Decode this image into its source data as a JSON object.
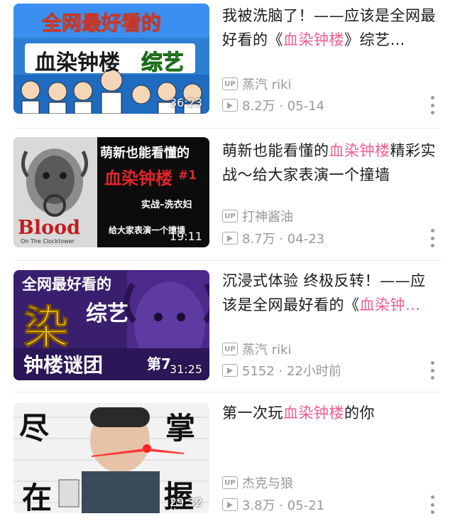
{
  "videos": [
    {
      "title_parts": [
        "我被洗脑了！——应该是全网最好看的《",
        "血染钟楼",
        "》综艺…"
      ],
      "uploader": "蒸汽 riki",
      "stats": "8.2万 · 05-14",
      "duration": "36:23",
      "thumb_text": {
        "line1": "全网最好看的",
        "line2": "血染钟楼",
        "line2b": "综艺"
      }
    },
    {
      "title_parts": [
        "萌新也能看懂的",
        "血染钟楼",
        "精彩实战～给大家表演一个撞墙"
      ],
      "uploader": "打神酱油",
      "stats": "8.7万 · 04-23",
      "duration": "19:11",
      "thumb_text": {
        "line1": "萌新也能看懂的",
        "line2": "血染钟楼",
        "line2b": "#1",
        "line3": "实战–洗衣妇",
        "line4": "给大家表演一个撞墙",
        "logo": "Blood",
        "logo_sub": "On The Clocktower"
      }
    },
    {
      "title_parts": [
        "沉浸式体验 终极反转！——应该是全网最好看的《",
        "血染钟…",
        ""
      ],
      "uploader": "蒸汽 riki",
      "stats": "5152 · 22小时前",
      "duration": "31:25",
      "thumb_text": {
        "line1": "全网最好看的",
        "big": "染",
        "line2b": "综艺",
        "line3": "钟楼谜团",
        "ep": "第7"
      }
    },
    {
      "title_parts": [
        "第一次玩",
        "血染钟楼",
        "的你"
      ],
      "uploader": "杰克与狼",
      "stats": "3.8万 · 05-21",
      "duration": "29:32",
      "thumb_text": {
        "c1": "尽",
        "c2": "掌",
        "c3": "握",
        "c4": "在"
      }
    }
  ],
  "badges": {
    "up": "UP"
  },
  "colors": {
    "highlight": "#f25d8e",
    "meta": "#999999",
    "title": "#1a1a1a"
  },
  "icons": {
    "up": "up-badge-icon",
    "play": "play-count-icon",
    "more": "more-vertical-icon"
  }
}
